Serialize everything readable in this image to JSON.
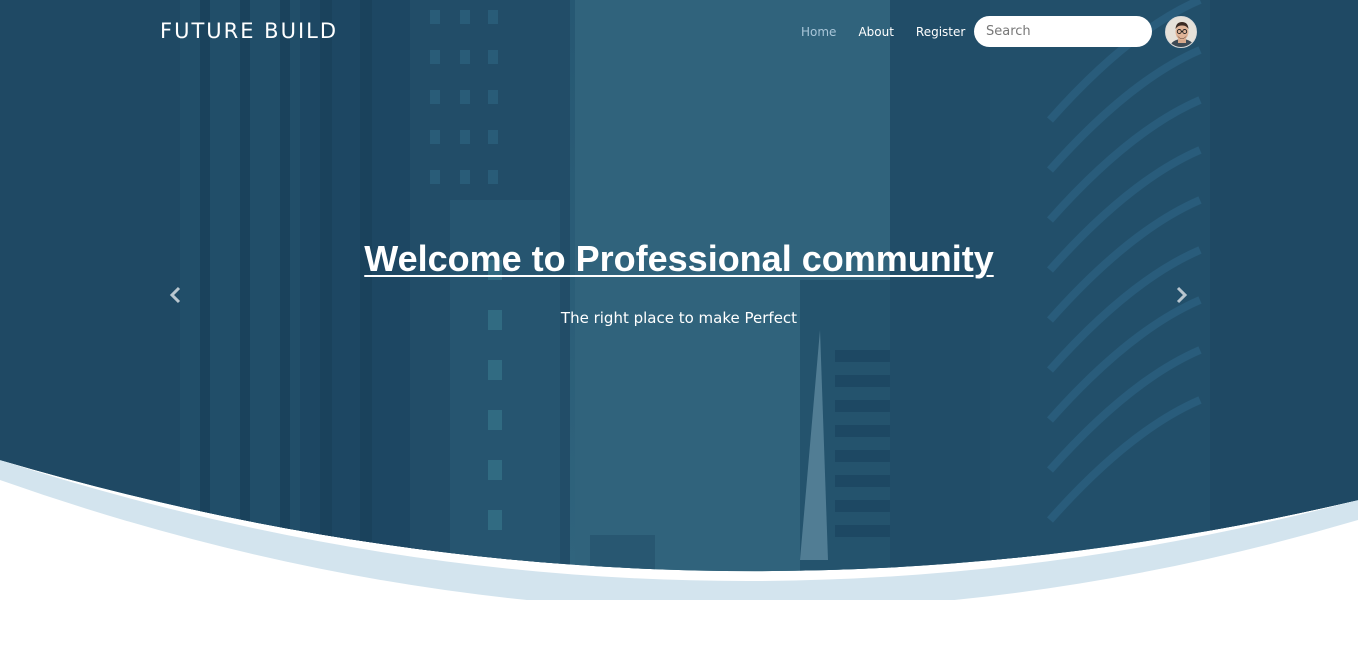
{
  "header": {
    "brand": "FUTURE BUILD",
    "nav": [
      {
        "label": "Home",
        "active": true
      },
      {
        "label": "About",
        "active": false
      },
      {
        "label": "Register",
        "active": false
      }
    ],
    "search": {
      "placeholder": "Search",
      "value": ""
    },
    "avatar_icon": "user-avatar-icon"
  },
  "hero": {
    "title": "Welcome to Professional community",
    "subtitle": "The right place to make Perfect",
    "prev_icon": "chevron-left-icon",
    "next_icon": "chevron-right-icon",
    "overlay_color": "#1f4c6b",
    "wave_color": "#d3e4ee"
  }
}
